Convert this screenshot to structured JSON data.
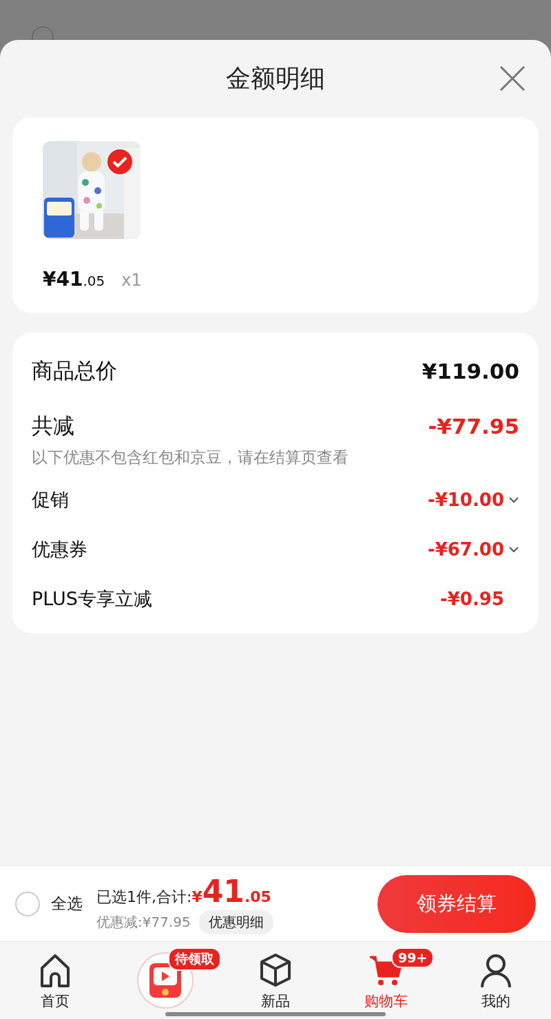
{
  "sheet": {
    "title": "金额明细"
  },
  "items": [
    {
      "kind": "picture",
      "selected": true,
      "currency": "¥",
      "price_int": "41",
      "price_dec": ".05",
      "quantity": "x1"
    }
  ],
  "summary": [
    {
      "kind": "total",
      "label": "商品总价",
      "value": "¥119.00"
    },
    {
      "kind": "discount",
      "label": "共减",
      "value": "-¥77.95",
      "note": "以下优惠不包含红包和京豆，请在结算页查看"
    },
    {
      "kind": "detail",
      "label": "促销",
      "value": "-¥10.00",
      "expandable": true
    },
    {
      "kind": "detail",
      "label": "优惠券",
      "value": "-¥67.00",
      "expandable": true
    },
    {
      "kind": "detail",
      "label": "PLUS专享立减",
      "value": "-¥0.95",
      "expandable": false
    }
  ],
  "bottom_bar": {
    "select_all": {
      "label": "全选",
      "checked": false
    },
    "selected_text": "已选1件,合计:",
    "currency": "¥",
    "total_int": "41",
    "total_dec": ".05",
    "discount_text": "优惠减:¥77.95",
    "details_button": "优惠明细",
    "checkout_button": "领券结算"
  },
  "tabs": [
    {
      "kind": "home",
      "label": "首页",
      "selected": false
    },
    {
      "kind": "promo",
      "badge": "待领取"
    },
    {
      "kind": "new",
      "label": "新品",
      "selected": false
    },
    {
      "kind": "cart",
      "label": "购物车",
      "badge": "99+",
      "selected": true
    },
    {
      "kind": "me",
      "label": "我的",
      "selected": false
    }
  ]
}
